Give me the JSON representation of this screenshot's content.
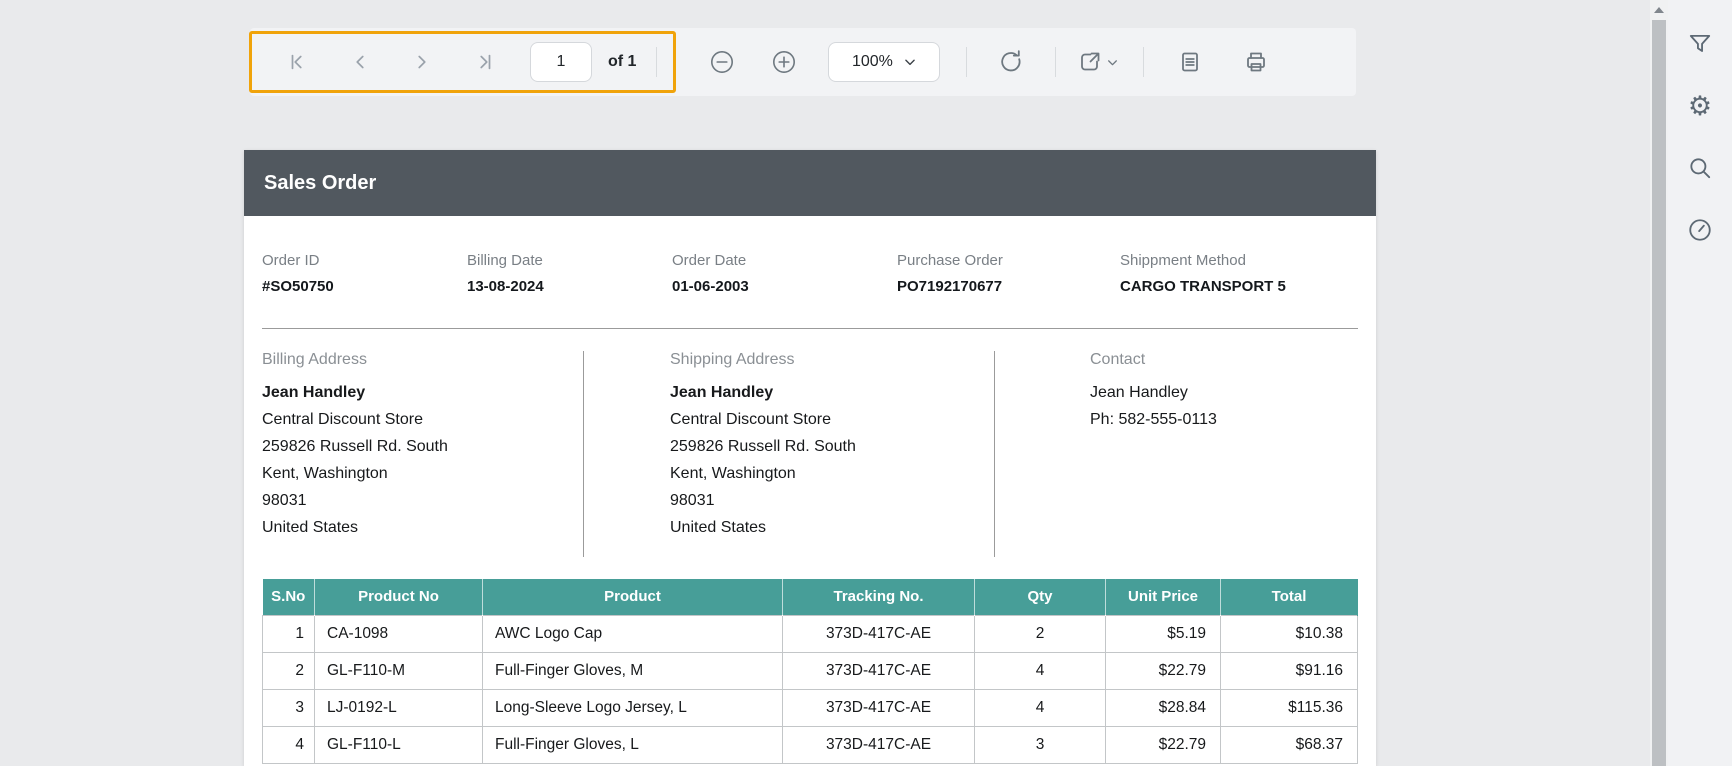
{
  "toolbar": {
    "page_input": "1",
    "of_label": "of 1",
    "zoom_value": "100%"
  },
  "report": {
    "title": "Sales Order",
    "fields": [
      {
        "label": "Order ID",
        "value": "#SO50750"
      },
      {
        "label": "Billing Date",
        "value": "13-08-2024"
      },
      {
        "label": "Order Date",
        "value": "01-06-2003"
      },
      {
        "label": "Purchase Order",
        "value": "PO7192170677"
      },
      {
        "label": "Shippment Method",
        "value": "CARGO TRANSPORT 5"
      }
    ],
    "addresses": {
      "billing": {
        "heading": "Billing Address",
        "lines": [
          "Jean Handley",
          "Central Discount Store",
          "259826 Russell Rd. South",
          "Kent, Washington",
          "98031",
          "United States"
        ]
      },
      "shipping": {
        "heading": "Shipping Address",
        "lines": [
          "Jean Handley",
          "Central Discount Store",
          "259826 Russell Rd. South",
          "Kent, Washington",
          "98031",
          "United States"
        ]
      },
      "contact": {
        "heading": "Contact",
        "lines": [
          "Jean Handley",
          "Ph: 582-555-0113"
        ]
      }
    },
    "table": {
      "columns": [
        "S.No",
        "Product No",
        "Product",
        "Tracking No.",
        "Qty",
        "Unit Price",
        "Total"
      ],
      "rows": [
        [
          "1",
          "CA-1098",
          "AWC Logo Cap",
          "373D-417C-AE",
          "2",
          "$5.19",
          "$10.38"
        ],
        [
          "2",
          "GL-F110-M",
          "Full-Finger Gloves, M",
          "373D-417C-AE",
          "4",
          "$22.79",
          "$91.16"
        ],
        [
          "3",
          "LJ-0192-L",
          "Long-Sleeve Logo Jersey, L",
          "373D-417C-AE",
          "4",
          "$28.84",
          "$115.36"
        ],
        [
          "4",
          "GL-F110-L",
          "Full-Finger Gloves, L",
          "373D-417C-AE",
          "3",
          "$22.79",
          "$68.37"
        ]
      ]
    }
  },
  "colors": {
    "accent_orange": "#f0a30a",
    "header_band": "#51585f",
    "table_header_teal": "#479e98",
    "toolbar_bg": "#f2f3f5",
    "viewer_bg": "#e9eaec"
  }
}
